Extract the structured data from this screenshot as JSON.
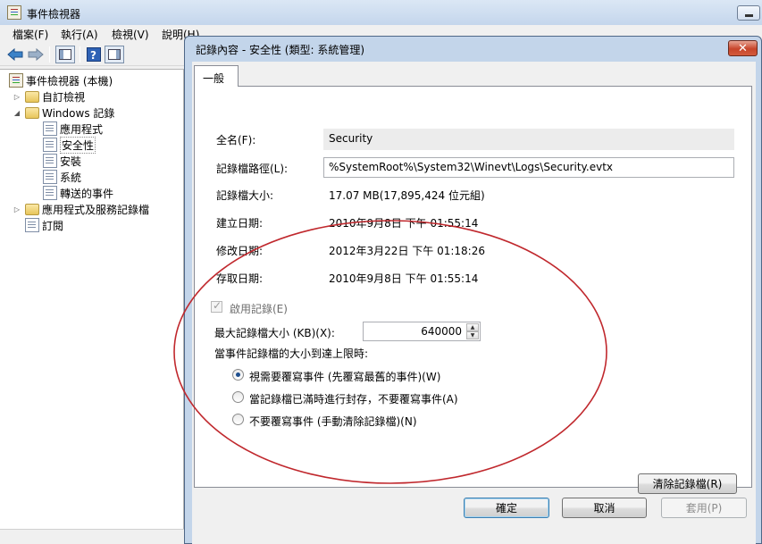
{
  "main_window": {
    "title": "事件檢視器",
    "menu": [
      "檔案(F)",
      "執行(A)",
      "檢視(V)",
      "說明(H)"
    ]
  },
  "tree": {
    "root": "事件檢視器 (本機)",
    "items": [
      {
        "label": "自訂檢視"
      },
      {
        "label": "Windows 記錄"
      },
      {
        "label": "應用程式"
      },
      {
        "label": "安全性"
      },
      {
        "label": "安裝"
      },
      {
        "label": "系統"
      },
      {
        "label": "轉送的事件"
      },
      {
        "label": "應用程式及服務記錄檔"
      },
      {
        "label": "訂閱"
      }
    ]
  },
  "dialog": {
    "title": "記錄內容 - 安全性 (類型: 系統管理)",
    "tab": "一般",
    "fullname_label": "全名(F):",
    "fullname_value": "Security",
    "path_label": "記錄檔路徑(L):",
    "path_value": "%SystemRoot%\\System32\\Winevt\\Logs\\Security.evtx",
    "size_label": "記錄檔大小:",
    "size_value": "17.07 MB(17,895,424 位元組)",
    "created_label": "建立日期:",
    "created_value": "2010年9月8日 下午 01:55:14",
    "modified_label": "修改日期:",
    "modified_value": "2012年3月22日 下午 01:18:26",
    "accessed_label": "存取日期:",
    "accessed_value": "2010年9月8日 下午 01:55:14",
    "enable_label": "啟用記錄(E)",
    "enable_checked": true,
    "maxsize_label": "最大記錄檔大小 (KB)(X):",
    "maxsize_value": "640000",
    "when_max_label": "當事件記錄檔的大小到達上限時:",
    "options": [
      {
        "label": "視需要覆寫事件 (先覆寫最舊的事件)(W)",
        "checked": true
      },
      {
        "label": "當記錄檔已滿時進行封存，不要覆寫事件(A)",
        "checked": false
      },
      {
        "label": "不要覆寫事件 (手動清除記錄檔)(N)",
        "checked": false
      }
    ],
    "clear_button": "清除記錄檔(R)",
    "ok_button": "確定",
    "cancel_button": "取消",
    "apply_button": "套用(P)",
    "annotation_color": "#c0282d"
  }
}
